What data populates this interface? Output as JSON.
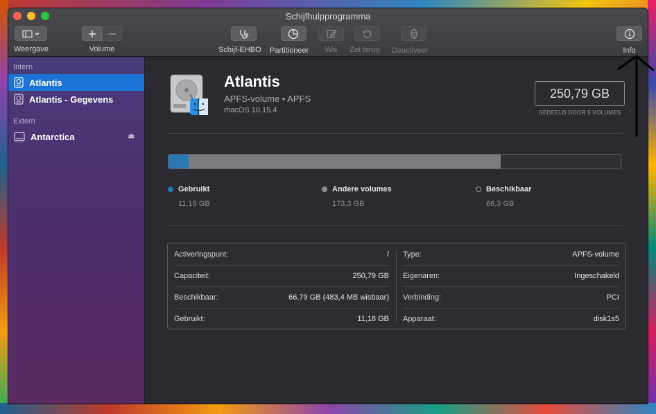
{
  "window": {
    "title": "Schijfhulpprogramma"
  },
  "toolbar": {
    "view_label": "Weergave",
    "volume_label": "Volume",
    "first_aid_label": "Schijf-EHBO",
    "partition_label": "Partitioneer",
    "erase_label": "Wis",
    "restore_label": "Zet terug",
    "unmount_label": "Deactiveer",
    "info_label": "Info"
  },
  "sidebar": {
    "section_internal": "Intern",
    "section_external": "Extern",
    "internal_items": [
      {
        "label": "Atlantis",
        "selected": true
      },
      {
        "label": "Atlantis - Gegevens",
        "selected": false
      }
    ],
    "external_items": [
      {
        "label": "Antarctica"
      }
    ]
  },
  "volume": {
    "name": "Atlantis",
    "type": "APFS-volume • APFS",
    "os": "macOS 10.15.4",
    "capacity": "250,79 GB",
    "capacity_note": "GEDEELD DOOR 5 VOLUMES"
  },
  "usage": {
    "used_fraction": 0.0446,
    "other_fraction": 0.6908,
    "colors": {
      "used": "#2a79b5",
      "other": "#7c7c80",
      "free": "#2f2e34"
    },
    "legend": [
      {
        "label": "Gebruikt",
        "value": "11,18 GB"
      },
      {
        "label": "Andere volumes",
        "value": "173,3 GB"
      },
      {
        "label": "Beschikbaar",
        "value": "66,3 GB"
      }
    ]
  },
  "details": {
    "left": [
      {
        "key": "Activeringspunt:",
        "value": "/"
      },
      {
        "key": "Capaciteit:",
        "value": "250,79 GB"
      },
      {
        "key": "Beschikbaar:",
        "value": "66,79 GB (483,4 MB wisbaar)"
      },
      {
        "key": "Gebruikt:",
        "value": "11,18 GB"
      }
    ],
    "right": [
      {
        "key": "Type:",
        "value": "APFS-volume"
      },
      {
        "key": "Eigenaren:",
        "value": "Ingeschakeld"
      },
      {
        "key": "Verbinding:",
        "value": "PCI"
      },
      {
        "key": "Apparaat:",
        "value": "disk1s5"
      }
    ]
  }
}
